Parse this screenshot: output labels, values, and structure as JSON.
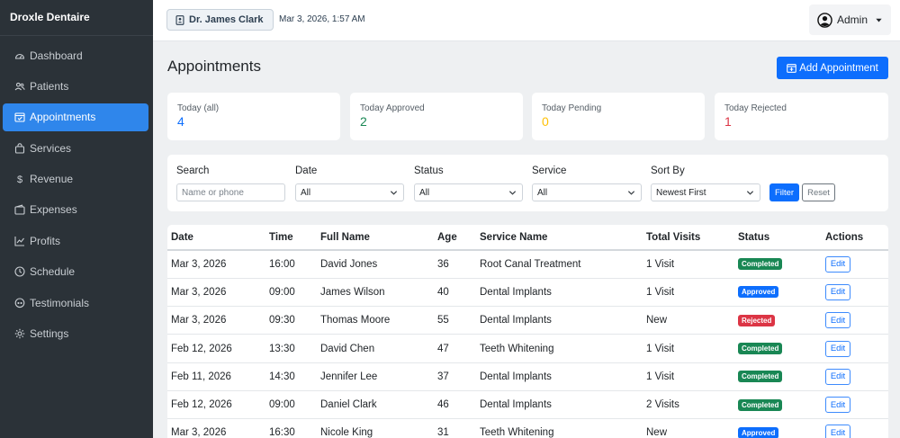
{
  "app": {
    "brand": "Droxle Dentaire"
  },
  "sidebar": {
    "items": [
      {
        "label": "Dashboard",
        "icon": "dashboard-icon",
        "active": false
      },
      {
        "label": "Patients",
        "icon": "users-icon",
        "active": false
      },
      {
        "label": "Appointments",
        "icon": "calendar-icon",
        "active": true
      },
      {
        "label": "Services",
        "icon": "bag-icon",
        "active": false
      },
      {
        "label": "Revenue",
        "icon": "dollar-icon",
        "active": false
      },
      {
        "label": "Expenses",
        "icon": "wallet-icon",
        "active": false
      },
      {
        "label": "Profits",
        "icon": "chart-icon",
        "active": false
      },
      {
        "label": "Schedule",
        "icon": "clock-icon",
        "active": false
      },
      {
        "label": "Testimonials",
        "icon": "chat-icon",
        "active": false
      },
      {
        "label": "Settings",
        "icon": "gear-icon",
        "active": false
      }
    ]
  },
  "topbar": {
    "doctor": "Dr. James Clark",
    "datetime": "Mar 3, 2026, 1:57 AM",
    "user": "Admin"
  },
  "page": {
    "title": "Appointments",
    "add_button": "Add Appointment"
  },
  "stats": [
    {
      "label": "Today (all)",
      "value": "4",
      "color": "#0d6efd"
    },
    {
      "label": "Today Approved",
      "value": "2",
      "color": "#198754"
    },
    {
      "label": "Today Pending",
      "value": "0",
      "color": "#ffc107"
    },
    {
      "label": "Today Rejected",
      "value": "1",
      "color": "#dc3545"
    }
  ],
  "filters": {
    "search_label": "Search",
    "search_placeholder": "Name or phone",
    "date_label": "Date",
    "date_value": "All",
    "status_label": "Status",
    "status_value": "All",
    "service_label": "Service",
    "service_value": "All",
    "sort_label": "Sort By",
    "sort_value": "Newest First",
    "filter_button": "Filter",
    "reset_button": "Reset"
  },
  "table": {
    "headers": [
      "Date",
      "Time",
      "Full Name",
      "Age",
      "Service Name",
      "Total Visits",
      "Status",
      "Actions"
    ],
    "edit_label": "Edit",
    "status_colors": {
      "Completed": "#198754",
      "Approved": "#0d6efd",
      "Rejected": "#dc3545"
    },
    "rows": [
      {
        "date": "Mar 3, 2026",
        "time": "16:00",
        "name": "David Jones",
        "age": "36",
        "service": "Root Canal Treatment",
        "visits": "1 Visit",
        "status": "Completed"
      },
      {
        "date": "Mar 3, 2026",
        "time": "09:00",
        "name": "James Wilson",
        "age": "40",
        "service": "Dental Implants",
        "visits": "1 Visit",
        "status": "Approved"
      },
      {
        "date": "Mar 3, 2026",
        "time": "09:30",
        "name": "Thomas Moore",
        "age": "55",
        "service": "Dental Implants",
        "visits": "New",
        "status": "Rejected"
      },
      {
        "date": "Feb 12, 2026",
        "time": "13:30",
        "name": "David Chen",
        "age": "47",
        "service": "Teeth Whitening",
        "visits": "1 Visit",
        "status": "Completed"
      },
      {
        "date": "Feb 11, 2026",
        "time": "14:30",
        "name": "Jennifer Lee",
        "age": "37",
        "service": "Dental Implants",
        "visits": "1 Visit",
        "status": "Completed"
      },
      {
        "date": "Feb 12, 2026",
        "time": "09:00",
        "name": "Daniel Clark",
        "age": "46",
        "service": "Dental Implants",
        "visits": "2 Visits",
        "status": "Completed"
      },
      {
        "date": "Mar 3, 2026",
        "time": "16:30",
        "name": "Nicole King",
        "age": "31",
        "service": "Teeth Whitening",
        "visits": "New",
        "status": "Approved"
      }
    ]
  }
}
